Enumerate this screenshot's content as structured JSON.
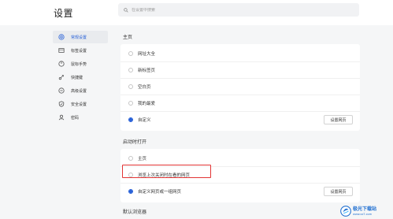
{
  "header": {
    "title": "设置",
    "search_placeholder": "在设置中搜索"
  },
  "sidebar": {
    "items": [
      {
        "label": "常规设置",
        "icon": "gear-circle-icon",
        "active": true
      },
      {
        "label": "标签设置",
        "icon": "tab-icon",
        "active": false
      },
      {
        "label": "鼠标手势",
        "icon": "mouse-icon",
        "active": false
      },
      {
        "label": "快捷键",
        "icon": "shortcut-icon",
        "active": false
      },
      {
        "label": "高级设置",
        "icon": "advanced-icon",
        "active": false
      },
      {
        "label": "安全设置",
        "icon": "shield-icon",
        "active": false
      },
      {
        "label": "密码",
        "icon": "user-key-icon",
        "active": false
      }
    ]
  },
  "homepage": {
    "title": "主页",
    "options": [
      {
        "label": "网址大全",
        "checked": false
      },
      {
        "label": "新标签页",
        "checked": false
      },
      {
        "label": "空白页",
        "checked": false
      },
      {
        "label": "我的最爱",
        "checked": false
      },
      {
        "label": "自定义",
        "checked": true
      }
    ],
    "button_label": "设置网页"
  },
  "startup": {
    "title": "启动时打开",
    "options": [
      {
        "label": "主页",
        "checked": false
      },
      {
        "label": "浏览上次关闭时在看的网页",
        "checked": false
      },
      {
        "label": "自定义网页或一组网页",
        "checked": true
      }
    ],
    "button_label": "设置网页"
  },
  "default_browser": {
    "title": "默认浏览器"
  },
  "watermark": {
    "name": "极光下载站",
    "url": "www.xz7.com"
  },
  "colors": {
    "accent": "#2a62d8",
    "highlight": "#e23434"
  }
}
